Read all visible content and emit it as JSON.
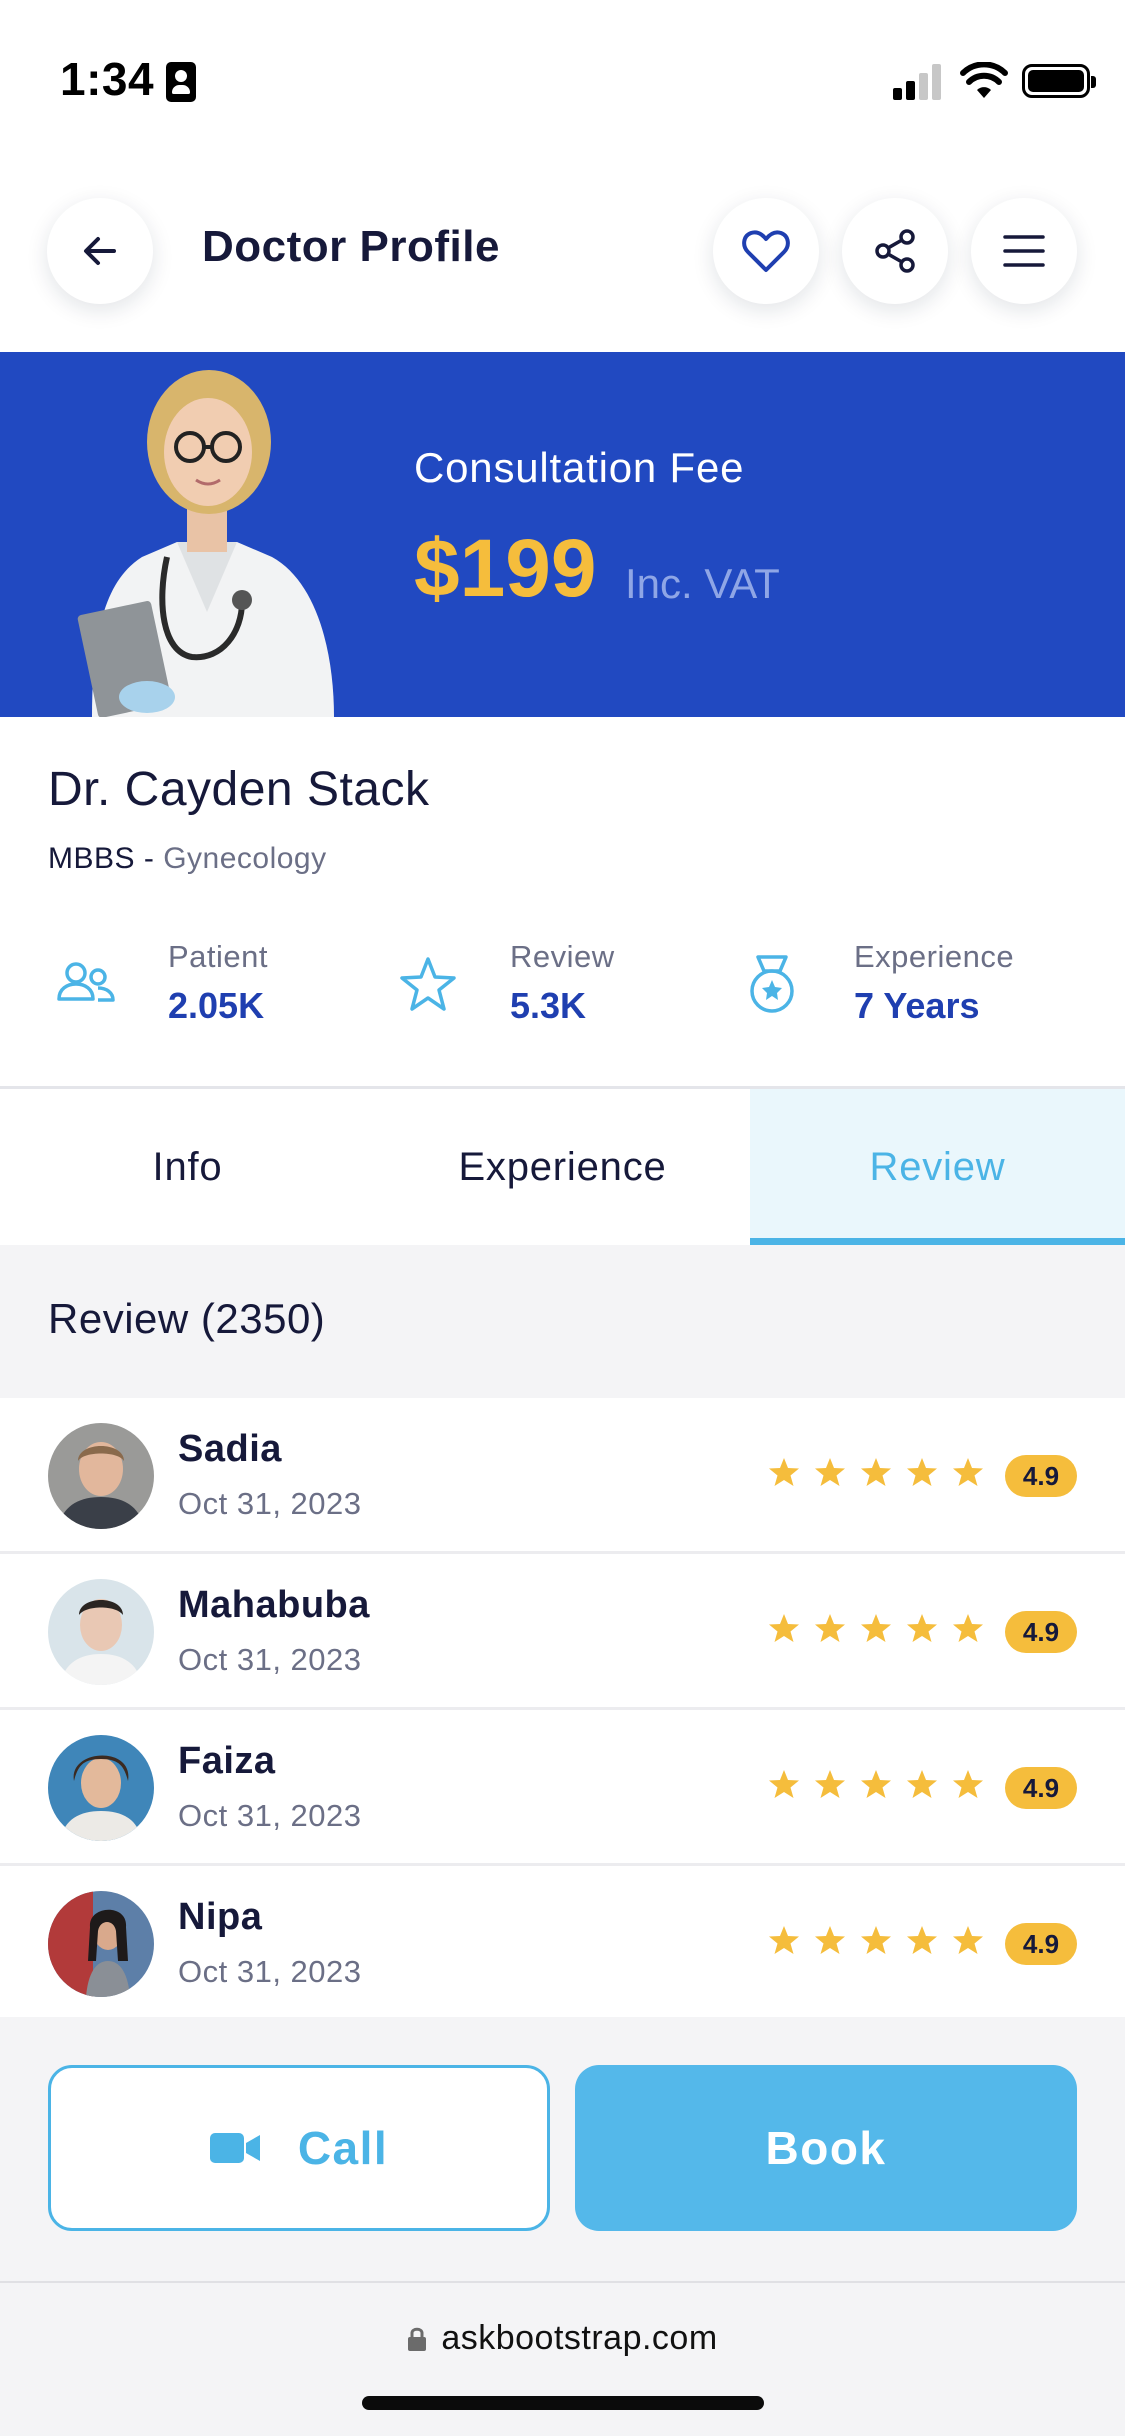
{
  "status_bar": {
    "time": "1:34"
  },
  "header": {
    "title": "Doctor Profile"
  },
  "banner": {
    "fee_label": "Consultation Fee",
    "fee_price": "$199",
    "fee_note": "Inc. VAT"
  },
  "doctor": {
    "name": "Dr. Cayden Stack",
    "degree": "MBBS - ",
    "specialty": "Gynecology"
  },
  "stats": [
    {
      "label": "Patient",
      "value": "2.05K",
      "icon": "users-icon"
    },
    {
      "label": "Review",
      "value": "5.3K",
      "icon": "star-outline-icon"
    },
    {
      "label": "Experience",
      "value": "7 Years",
      "icon": "medal-icon"
    }
  ],
  "tabs": [
    {
      "label": "Info",
      "active": false
    },
    {
      "label": "Experience",
      "active": false
    },
    {
      "label": "Review",
      "active": true
    }
  ],
  "reviews": {
    "heading": "Review (2350)",
    "items": [
      {
        "name": "Sadia",
        "date": "Oct 31, 2023",
        "stars": 5,
        "rating": "4.9"
      },
      {
        "name": "Mahabuba",
        "date": "Oct 31, 2023",
        "stars": 5,
        "rating": "4.9"
      },
      {
        "name": "Faiza",
        "date": "Oct 31, 2023",
        "stars": 5,
        "rating": "4.9"
      },
      {
        "name": "Nipa",
        "date": "Oct 31, 2023",
        "stars": 5,
        "rating": "4.9"
      }
    ]
  },
  "actions": {
    "call_label": "Call",
    "book_label": "Book"
  },
  "browser": {
    "url": "askbootstrap.com"
  },
  "colors": {
    "banner": "#2149c1",
    "price": "#f5bd3c",
    "accent": "#4bb4e6",
    "stat_value": "#1f3fb0",
    "star": "#f5bd3c"
  }
}
